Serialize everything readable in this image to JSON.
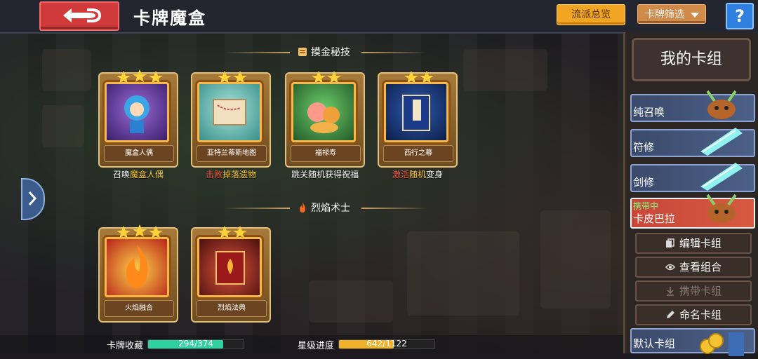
{
  "header": {
    "title": "卡牌魔盒",
    "school_overview_label": "流派总览",
    "card_filter_label": "卡牌筛选",
    "help_label": "?"
  },
  "sections": [
    {
      "title": "摸金秘技",
      "cards": [
        {
          "name": "魔盒人偶",
          "stars": 3,
          "effect_pre": "召唤",
          "effect_hl": "魔盒人偶",
          "effect_post": "",
          "art_color": "#7b3fb0"
        },
        {
          "name": "亚特兰蒂斯地图",
          "stars": 2,
          "effect_pre": "击败",
          "effect_hl": "掉落",
          "effect_post": "遗物",
          "art_color": "#5fb7b0"
        },
        {
          "name": "福禄寿",
          "stars": 2,
          "effect_pre": "跳关随机获得",
          "effect_hl": "",
          "effect_post": "祝福",
          "art_color": "#3f9a4a"
        },
        {
          "name": "西行之幕",
          "stars": 2,
          "effect_pre": "激活",
          "effect_hl": "随机",
          "effect_post": "变身",
          "art_color": "#1f3d7a"
        }
      ]
    },
    {
      "title": "烈焰术士",
      "cards": [
        {
          "name": "火焰融合",
          "stars": 3,
          "art_color": "#d84c1c"
        },
        {
          "name": "烈焰法典",
          "stars": 2,
          "art_color": "#a31f1f"
        }
      ]
    }
  ],
  "stats": {
    "collection_label": "卡牌收藏",
    "collection_value": "294/374",
    "collection_fraction": 0.786,
    "star_label": "星级进度",
    "star_value": "642/1122",
    "star_fraction": 0.572
  },
  "deck_panel": {
    "title": "我的卡组",
    "decks": [
      {
        "label": "纯召唤",
        "carried": false
      },
      {
        "label": "符修",
        "carried": false
      },
      {
        "label": "剑修",
        "carried": false
      },
      {
        "label": "卡皮巴拉",
        "carried": true,
        "carried_tag": "携带中"
      }
    ],
    "actions": {
      "edit": "编辑卡组",
      "view": "查看组合",
      "carry": "携带卡组",
      "rename": "命名卡组"
    },
    "default_deck_label": "默认卡组"
  },
  "colors": {
    "accent_orange": "#f0a623",
    "back_red": "#d13a3a",
    "help_blue": "#2f7fe0",
    "collection_bar": "#2fd1a0",
    "star_bar": "#f0b22a"
  }
}
